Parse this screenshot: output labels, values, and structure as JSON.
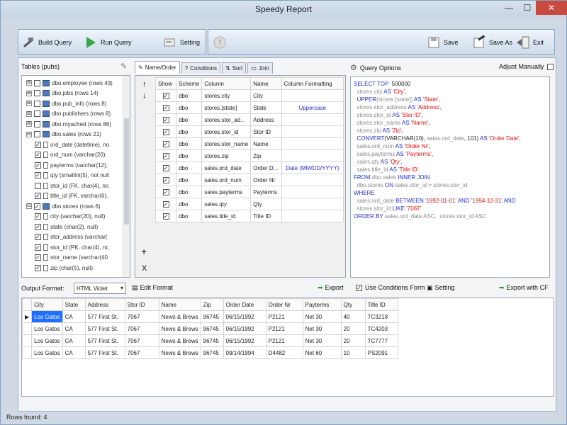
{
  "window": {
    "title": "Speedy Report",
    "minimize": "—",
    "maximize": "☐",
    "close": "✕"
  },
  "toolbar": {
    "build": "Build Query",
    "run": "Run Query",
    "setting": "Setting",
    "save": "Save",
    "save_as": "Save As",
    "exit": "Exit"
  },
  "left": {
    "title": "Tables (pubs)",
    "tree": [
      {
        "e": "⊞",
        "t": "dbo.employee (rows 43)",
        "c": false
      },
      {
        "e": "⊞",
        "t": "dbo.jobs (rows 14)",
        "c": false
      },
      {
        "e": "⊞",
        "t": "dbo.pub_info (rows 8)",
        "c": false
      },
      {
        "e": "⊞",
        "t": "dbo.publishers (rows 8)",
        "c": false
      },
      {
        "e": "⊞",
        "t": "dbo.royached (rows 86)",
        "c": false
      },
      {
        "e": "⊟",
        "t": "dbo.sales (rows 21)",
        "c": false
      },
      {
        "e": "",
        "t": "ord_date (datetime), no",
        "c": true,
        "i": 1
      },
      {
        "e": "",
        "t": "ord_num (varchar(20), ",
        "c": true,
        "i": 1
      },
      {
        "e": "",
        "t": "payterms (varchar(12),",
        "c": true,
        "i": 1
      },
      {
        "e": "",
        "t": "qty (smallint(5), not null",
        "c": true,
        "i": 1
      },
      {
        "e": "",
        "t": "stor_id (FK, char(4), no",
        "c": false,
        "i": 1
      },
      {
        "e": "",
        "t": "title_id (FK, varchar(6),",
        "c": true,
        "i": 1
      },
      {
        "e": "⊟",
        "t": "dbo.stores (rows 6)",
        "c": true
      },
      {
        "e": "",
        "t": "city (varchar(20), null)",
        "c": true,
        "i": 1
      },
      {
        "e": "",
        "t": "state (char(2), null)",
        "c": true,
        "i": 1
      },
      {
        "e": "",
        "t": "stor_address (varchar(",
        "c": true,
        "i": 1
      },
      {
        "e": "",
        "t": "stor_id (PK, char(4), nc",
        "c": true,
        "i": 1
      },
      {
        "e": "",
        "t": "stor_name (varchar(40",
        "c": true,
        "i": 1
      },
      {
        "e": "",
        "t": "zip (char(5), null)",
        "c": true,
        "i": 1
      }
    ]
  },
  "mid": {
    "tabs": [
      "Name/Order",
      "Conditions",
      "Sort",
      "Join"
    ],
    "headers": [
      "Show",
      "Scheme",
      "Column",
      "Name",
      "Column Formatting"
    ],
    "rows": [
      [
        "dbo",
        "stores.city",
        "City",
        ""
      ],
      [
        "dbo",
        "stores.[state]",
        "State",
        "Uppercase"
      ],
      [
        "dbo",
        "stores.stor_ad...",
        "Address",
        ""
      ],
      [
        "dbo",
        "stores.stor_id",
        "Stor ID",
        ""
      ],
      [
        "dbo",
        "stores.stor_name",
        "Name",
        ""
      ],
      [
        "dbo",
        "stores.zip",
        "Zip",
        ""
      ],
      [
        "dbo",
        "sales.ord_date",
        "Order D...",
        "Date (MM/DD/YYYY)"
      ],
      [
        "dbo",
        "sales.ord_num",
        "Order Nr",
        ""
      ],
      [
        "dbo",
        "sales.payterms",
        "Payterms",
        ""
      ],
      [
        "dbo",
        "sales.qty",
        "Qty",
        ""
      ],
      [
        "dbo",
        "sales.title_id",
        "Title ID",
        ""
      ]
    ],
    "up": "↑",
    "down": "↓",
    "add": "+",
    "remove": "X"
  },
  "right": {
    "title": "Query Options",
    "adjust": "Adjust Manually"
  },
  "sql": [
    [
      [
        "kw",
        "SELECT TOP"
      ],
      [
        "",
        "  500000"
      ]
    ],
    [
      [
        "gr",
        "  stores.city"
      ],
      [
        "kw",
        " AS "
      ],
      [
        "str",
        "'City'"
      ],
      [
        "",
        ","
      ]
    ],
    [
      [
        "kw",
        "  UPPER"
      ],
      [
        "gr",
        "(stores.[state])"
      ],
      [
        "kw",
        " AS "
      ],
      [
        "str",
        "'State'"
      ],
      [
        "",
        ","
      ]
    ],
    [
      [
        "gr",
        "  stores.stor_address"
      ],
      [
        "kw",
        " AS "
      ],
      [
        "str",
        "'Address'"
      ],
      [
        "",
        ","
      ]
    ],
    [
      [
        "gr",
        "  stores.stor_id"
      ],
      [
        "kw",
        " AS "
      ],
      [
        "str",
        "'Stor ID'"
      ],
      [
        "",
        ","
      ]
    ],
    [
      [
        "gr",
        "  stores.stor_name"
      ],
      [
        "kw",
        " AS "
      ],
      [
        "str",
        "'Name'"
      ],
      [
        "",
        ","
      ]
    ],
    [
      [
        "gr",
        "  stores.zip"
      ],
      [
        "kw",
        " AS "
      ],
      [
        "str",
        "'Zip'"
      ],
      [
        "",
        ","
      ]
    ],
    [
      [
        "kw",
        "  CONVERT"
      ],
      [
        "",
        "(VARCHAR(10), "
      ],
      [
        "gr",
        "sales.ord_date"
      ],
      [
        "",
        ", 101) "
      ],
      [
        "kw",
        "AS "
      ],
      [
        "str",
        "'Order Date'"
      ],
      [
        "",
        ","
      ]
    ],
    [
      [
        "gr",
        "  sales.ord_num"
      ],
      [
        "kw",
        " AS "
      ],
      [
        "str",
        "'Order Nr'"
      ],
      [
        "",
        ","
      ]
    ],
    [
      [
        "gr",
        "  sales.payterms"
      ],
      [
        "kw",
        " AS "
      ],
      [
        "str",
        "'Payterms'"
      ],
      [
        "",
        ","
      ]
    ],
    [
      [
        "gr",
        "  sales.qty"
      ],
      [
        "kw",
        " AS "
      ],
      [
        "str",
        "'Qty'"
      ],
      [
        "",
        ","
      ]
    ],
    [
      [
        "gr",
        "  sales.title_id"
      ],
      [
        "kw",
        " AS "
      ],
      [
        "str",
        "'Title ID'"
      ]
    ],
    [
      [
        "kw",
        "FROM "
      ],
      [
        "gr",
        "dbo.sales "
      ],
      [
        "kw",
        "INNER JOIN"
      ]
    ],
    [
      [
        "gr",
        "  dbo.stores "
      ],
      [
        "kw",
        "ON "
      ],
      [
        "gr",
        "sales.stor_id = stores.stor_id"
      ]
    ],
    [
      [
        "kw",
        "WHERE"
      ]
    ],
    [
      [
        "gr",
        "  sales.ord_date "
      ],
      [
        "kw",
        "BETWEEN "
      ],
      [
        "str",
        "'1992-01-01'"
      ],
      [
        "kw",
        " AND "
      ],
      [
        "str",
        "'1994-12-31'"
      ],
      [
        "kw",
        " AND"
      ]
    ],
    [
      [
        "gr",
        "  stores.stor_id "
      ],
      [
        "kw",
        "LIKE "
      ],
      [
        "str",
        "'7067'"
      ]
    ],
    [
      [
        "kw",
        "ORDER BY "
      ],
      [
        "gr",
        "sales.ord_date ASC,  stores.stor_id ASC"
      ]
    ]
  ],
  "output": {
    "label": "Output Format:",
    "format": "HTML Violet",
    "edit": "Edit Format",
    "export": "Export",
    "use_conditions": "Use Conditions Form",
    "setting": "Setting",
    "export_cf": "Export with CF"
  },
  "results": {
    "headers": [
      "City",
      "State",
      "Address",
      "Stor ID",
      "Name",
      "Zip",
      "Order Date",
      "Order Nr",
      "Payterms",
      "Qty",
      "Title ID"
    ],
    "rows": [
      [
        "Los Gatos",
        "CA",
        "577 First St.",
        "7067",
        "News & Brews",
        "96745",
        "06/15/1992",
        "P2121",
        "Net 30",
        "40",
        "TC3218"
      ],
      [
        "Los Gatos",
        "CA",
        "577 First St.",
        "7067",
        "News & Brews",
        "96745",
        "06/15/1992",
        "P2121",
        "Net 30",
        "20",
        "TC4203"
      ],
      [
        "Los Gatos",
        "CA",
        "577 First St.",
        "7067",
        "News & Brews",
        "96745",
        "06/15/1992",
        "P2121",
        "Net 30",
        "20",
        "TC7777"
      ],
      [
        "Los Gatos",
        "CA",
        "577 First St.",
        "7067",
        "News & Brews",
        "96745",
        "09/14/1994",
        "D4482",
        "Net 60",
        "10",
        "PS2091"
      ]
    ]
  },
  "status": "Rows found: 4"
}
